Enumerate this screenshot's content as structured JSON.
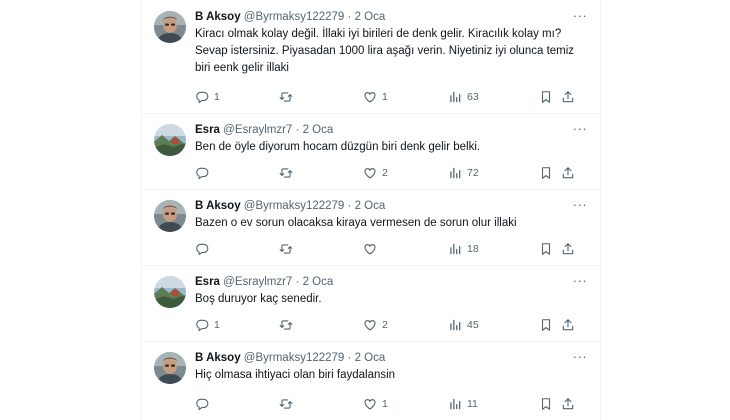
{
  "tweets": [
    {
      "name": "B Aksoy",
      "handle": "@Byrmaksy122279",
      "separator": "·",
      "date": "2 Oca",
      "more": "···",
      "lines": [
        "Kiracı olmak kolay değil. İllaki iyi birileri de denk gelir. Kiracılık kolay mı?",
        "Sevap istersiniz. Piyasadan 1000 lira aşağı verin. Niyetiniz iyi olunca temiz",
        "biri eenk gelir illaki"
      ],
      "replies": "1",
      "retweets": "",
      "likes": "1",
      "views": "63",
      "avatar": "man"
    },
    {
      "name": "Esra",
      "handle": "@Esraylmzr7",
      "separator": "·",
      "date": "2 Oca",
      "more": "···",
      "lines": [
        "Ben de öyle diyorum hocam düzgün biri denk gelir belki."
      ],
      "replies": "",
      "retweets": "",
      "likes": "2",
      "views": "72",
      "avatar": "landscape"
    },
    {
      "name": "B Aksoy",
      "handle": "@Byrmaksy122279",
      "separator": "·",
      "date": "2 Oca",
      "more": "···",
      "lines": [
        "Bazen o ev sorun olacaksa kiraya vermesen de sorun olur illaki"
      ],
      "replies": "",
      "retweets": "",
      "likes": "",
      "views": "18",
      "avatar": "man"
    },
    {
      "name": "Esra",
      "handle": "@Esraylmzr7",
      "separator": "·",
      "date": "2 Oca",
      "more": "···",
      "lines": [
        "Boş duruyor kaç senedir."
      ],
      "replies": "1",
      "retweets": "",
      "likes": "2",
      "views": "45",
      "avatar": "landscape"
    },
    {
      "name": "B Aksoy",
      "handle": "@Byrmaksy122279",
      "separator": "·",
      "date": "2 Oca",
      "more": "···",
      "lines": [
        "Hiç olmasa ihtiyaci olan biri faydalansin"
      ],
      "replies": "",
      "retweets": "",
      "likes": "1",
      "views": "11",
      "avatar": "man"
    }
  ],
  "colors": {
    "text": "#0f1419",
    "secondary": "#536471",
    "divider": "#eff3f4"
  },
  "icons": {
    "reply": "reply-icon",
    "retweet": "retweet-icon",
    "like": "like-icon",
    "views": "views-icon",
    "bookmark": "bookmark-icon",
    "share": "share-icon"
  }
}
